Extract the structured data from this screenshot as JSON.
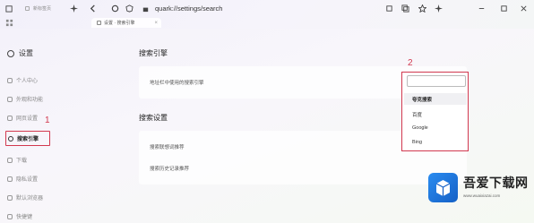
{
  "browser": {
    "left_tab_label": "新标签页",
    "active_tab_label": "设置 · 搜索引擎",
    "address": "quark://settings/search",
    "icons": [
      "restore-icon",
      "sparkle-icon",
      "back-icon",
      "reload-icon",
      "extension-icon",
      "copy-icon",
      "star-icon",
      "account-icon",
      "menu-icon"
    ]
  },
  "sidebar": {
    "title": "设置",
    "items": [
      {
        "label": "个人中心",
        "icon": "user-icon"
      },
      {
        "label": "外观和功能",
        "icon": "palette-icon"
      },
      {
        "label": "网页设置",
        "icon": "page-icon"
      },
      {
        "label": "搜索引擎",
        "icon": "search-icon"
      },
      {
        "label": "下载",
        "icon": "download-icon"
      },
      {
        "label": "隐私设置",
        "icon": "shield-icon"
      },
      {
        "label": "默认浏览器",
        "icon": "browser-icon"
      },
      {
        "label": "快捷键",
        "icon": "keyboard-icon"
      }
    ],
    "annotation": "1"
  },
  "main": {
    "engine_section_title": "搜索引擎",
    "engine_row_label": "地址栏中使用的搜索引擎",
    "search_settings_title": "搜索设置",
    "search_rows": [
      "搜索联想词推荐",
      "搜索历史记录推荐"
    ],
    "annotation": "2"
  },
  "dropdown": {
    "selected": "",
    "options": [
      "夸克搜索",
      "百度",
      "Google",
      "Bing"
    ],
    "highlight_color": "#d2384f"
  },
  "watermark": {
    "brand": "吾爱下载网",
    "url": "www.wuaixiazai.com"
  }
}
